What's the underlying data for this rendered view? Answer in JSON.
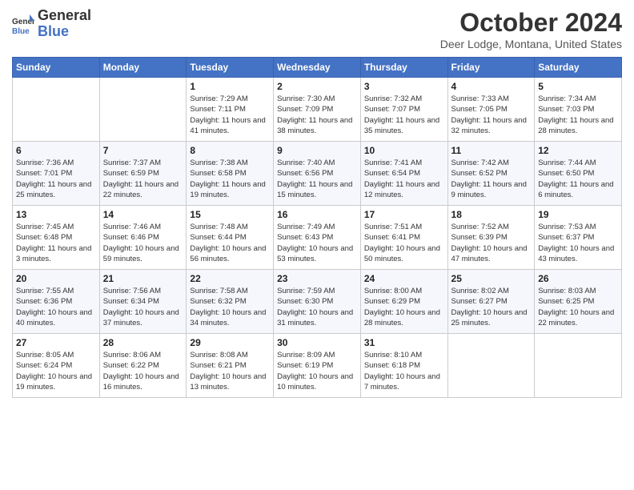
{
  "header": {
    "logo_line1": "General",
    "logo_line2": "Blue",
    "month_year": "October 2024",
    "location": "Deer Lodge, Montana, United States"
  },
  "weekdays": [
    "Sunday",
    "Monday",
    "Tuesday",
    "Wednesday",
    "Thursday",
    "Friday",
    "Saturday"
  ],
  "weeks": [
    [
      {
        "day": "",
        "info": ""
      },
      {
        "day": "",
        "info": ""
      },
      {
        "day": "1",
        "info": "Sunrise: 7:29 AM\nSunset: 7:11 PM\nDaylight: 11 hours and 41 minutes."
      },
      {
        "day": "2",
        "info": "Sunrise: 7:30 AM\nSunset: 7:09 PM\nDaylight: 11 hours and 38 minutes."
      },
      {
        "day": "3",
        "info": "Sunrise: 7:32 AM\nSunset: 7:07 PM\nDaylight: 11 hours and 35 minutes."
      },
      {
        "day": "4",
        "info": "Sunrise: 7:33 AM\nSunset: 7:05 PM\nDaylight: 11 hours and 32 minutes."
      },
      {
        "day": "5",
        "info": "Sunrise: 7:34 AM\nSunset: 7:03 PM\nDaylight: 11 hours and 28 minutes."
      }
    ],
    [
      {
        "day": "6",
        "info": "Sunrise: 7:36 AM\nSunset: 7:01 PM\nDaylight: 11 hours and 25 minutes."
      },
      {
        "day": "7",
        "info": "Sunrise: 7:37 AM\nSunset: 6:59 PM\nDaylight: 11 hours and 22 minutes."
      },
      {
        "day": "8",
        "info": "Sunrise: 7:38 AM\nSunset: 6:58 PM\nDaylight: 11 hours and 19 minutes."
      },
      {
        "day": "9",
        "info": "Sunrise: 7:40 AM\nSunset: 6:56 PM\nDaylight: 11 hours and 15 minutes."
      },
      {
        "day": "10",
        "info": "Sunrise: 7:41 AM\nSunset: 6:54 PM\nDaylight: 11 hours and 12 minutes."
      },
      {
        "day": "11",
        "info": "Sunrise: 7:42 AM\nSunset: 6:52 PM\nDaylight: 11 hours and 9 minutes."
      },
      {
        "day": "12",
        "info": "Sunrise: 7:44 AM\nSunset: 6:50 PM\nDaylight: 11 hours and 6 minutes."
      }
    ],
    [
      {
        "day": "13",
        "info": "Sunrise: 7:45 AM\nSunset: 6:48 PM\nDaylight: 11 hours and 3 minutes."
      },
      {
        "day": "14",
        "info": "Sunrise: 7:46 AM\nSunset: 6:46 PM\nDaylight: 10 hours and 59 minutes."
      },
      {
        "day": "15",
        "info": "Sunrise: 7:48 AM\nSunset: 6:44 PM\nDaylight: 10 hours and 56 minutes."
      },
      {
        "day": "16",
        "info": "Sunrise: 7:49 AM\nSunset: 6:43 PM\nDaylight: 10 hours and 53 minutes."
      },
      {
        "day": "17",
        "info": "Sunrise: 7:51 AM\nSunset: 6:41 PM\nDaylight: 10 hours and 50 minutes."
      },
      {
        "day": "18",
        "info": "Sunrise: 7:52 AM\nSunset: 6:39 PM\nDaylight: 10 hours and 47 minutes."
      },
      {
        "day": "19",
        "info": "Sunrise: 7:53 AM\nSunset: 6:37 PM\nDaylight: 10 hours and 43 minutes."
      }
    ],
    [
      {
        "day": "20",
        "info": "Sunrise: 7:55 AM\nSunset: 6:36 PM\nDaylight: 10 hours and 40 minutes."
      },
      {
        "day": "21",
        "info": "Sunrise: 7:56 AM\nSunset: 6:34 PM\nDaylight: 10 hours and 37 minutes."
      },
      {
        "day": "22",
        "info": "Sunrise: 7:58 AM\nSunset: 6:32 PM\nDaylight: 10 hours and 34 minutes."
      },
      {
        "day": "23",
        "info": "Sunrise: 7:59 AM\nSunset: 6:30 PM\nDaylight: 10 hours and 31 minutes."
      },
      {
        "day": "24",
        "info": "Sunrise: 8:00 AM\nSunset: 6:29 PM\nDaylight: 10 hours and 28 minutes."
      },
      {
        "day": "25",
        "info": "Sunrise: 8:02 AM\nSunset: 6:27 PM\nDaylight: 10 hours and 25 minutes."
      },
      {
        "day": "26",
        "info": "Sunrise: 8:03 AM\nSunset: 6:25 PM\nDaylight: 10 hours and 22 minutes."
      }
    ],
    [
      {
        "day": "27",
        "info": "Sunrise: 8:05 AM\nSunset: 6:24 PM\nDaylight: 10 hours and 19 minutes."
      },
      {
        "day": "28",
        "info": "Sunrise: 8:06 AM\nSunset: 6:22 PM\nDaylight: 10 hours and 16 minutes."
      },
      {
        "day": "29",
        "info": "Sunrise: 8:08 AM\nSunset: 6:21 PM\nDaylight: 10 hours and 13 minutes."
      },
      {
        "day": "30",
        "info": "Sunrise: 8:09 AM\nSunset: 6:19 PM\nDaylight: 10 hours and 10 minutes."
      },
      {
        "day": "31",
        "info": "Sunrise: 8:10 AM\nSunset: 6:18 PM\nDaylight: 10 hours and 7 minutes."
      },
      {
        "day": "",
        "info": ""
      },
      {
        "day": "",
        "info": ""
      }
    ]
  ]
}
